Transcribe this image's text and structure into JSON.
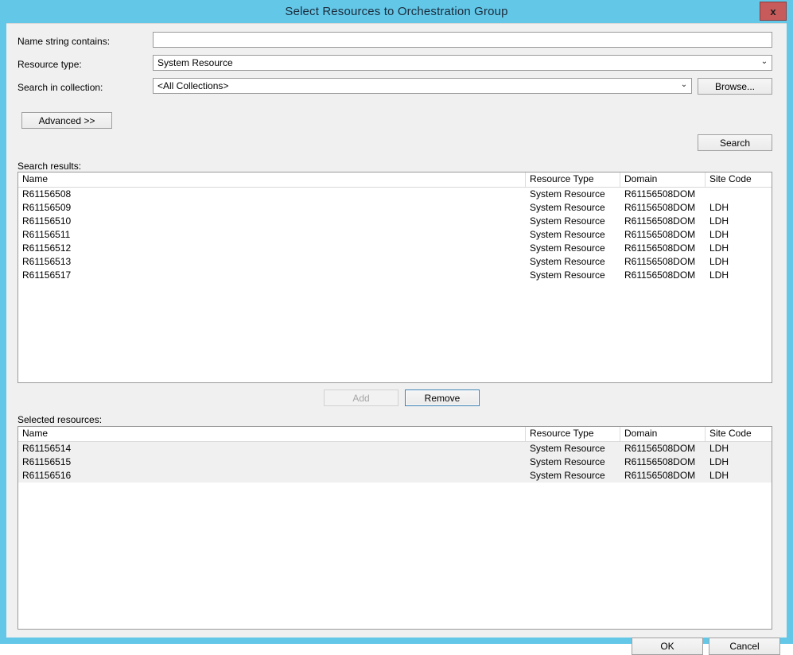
{
  "window": {
    "title": "Select Resources to Orchestration Group",
    "close_label": "x",
    "chrome_color": "#63c7e8",
    "client_color": "#f0f0f0"
  },
  "form": {
    "name_label": "Name string contains:",
    "name_value": "",
    "name_placeholder": "",
    "type_label": "Resource type:",
    "type_value": "System Resource",
    "collection_label": "Search in collection:",
    "collection_value": "<All Collections>",
    "browse_label": "Browse...",
    "advanced_label": "Advanced >>",
    "search_label": "Search",
    "dropdown_arrow": "⌄"
  },
  "search_results": {
    "section_label": "Search results:",
    "columns": [
      "Name",
      "Resource Type",
      "Domain",
      "Site Code"
    ],
    "rows": [
      {
        "name": "R61156508",
        "type": "System Resource",
        "domain": "R61156508DOM",
        "site": "",
        "selected": false
      },
      {
        "name": "R61156509",
        "type": "System Resource",
        "domain": "R61156508DOM",
        "site": "LDH",
        "selected": false
      },
      {
        "name": "R61156510",
        "type": "System Resource",
        "domain": "R61156508DOM",
        "site": "LDH",
        "selected": false
      },
      {
        "name": "R61156511",
        "type": "System Resource",
        "domain": "R61156508DOM",
        "site": "LDH",
        "selected": false
      },
      {
        "name": "R61156512",
        "type": "System Resource",
        "domain": "R61156508DOM",
        "site": "LDH",
        "selected": false
      },
      {
        "name": "R61156513",
        "type": "System Resource",
        "domain": "R61156508DOM",
        "site": "LDH",
        "selected": false
      },
      {
        "name": "R61156517",
        "type": "System Resource",
        "domain": "R61156508DOM",
        "site": "LDH",
        "selected": false
      }
    ]
  },
  "transfer": {
    "add_label": "Add",
    "add_enabled": false,
    "remove_label": "Remove",
    "remove_enabled": true,
    "remove_focused": true
  },
  "selected_resources": {
    "section_label": "Selected resources:",
    "columns": [
      "Name",
      "Resource Type",
      "Domain",
      "Site Code"
    ],
    "rows": [
      {
        "name": "R61156514",
        "type": "System Resource",
        "domain": "R61156508DOM",
        "site": "LDH",
        "selected": true
      },
      {
        "name": "R61156515",
        "type": "System Resource",
        "domain": "R61156508DOM",
        "site": "LDH",
        "selected": true
      },
      {
        "name": "R61156516",
        "type": "System Resource",
        "domain": "R61156508DOM",
        "site": "LDH",
        "selected": true
      }
    ]
  },
  "footer": {
    "ok_label": "OK",
    "cancel_label": "Cancel"
  }
}
